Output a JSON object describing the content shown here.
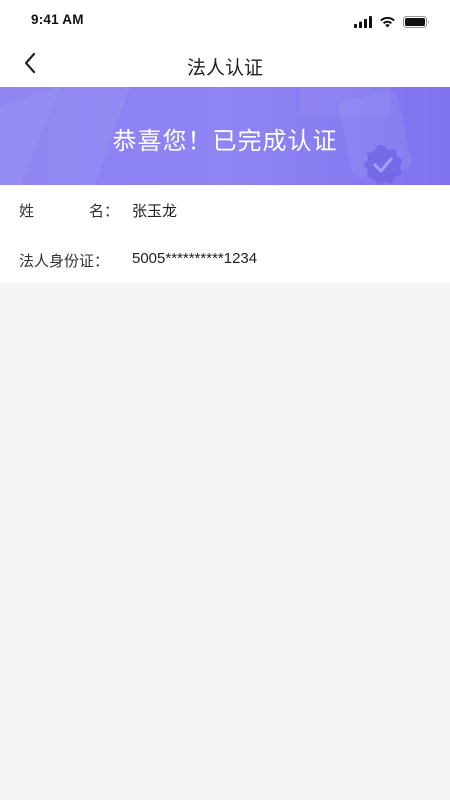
{
  "status_bar": {
    "time": "9:41 AM",
    "icons": [
      "cellular-signal-icon",
      "wifi-icon",
      "battery-icon"
    ]
  },
  "nav": {
    "title": "法人认证",
    "back_icon": "chevron-left-icon"
  },
  "banner": {
    "text": "恭喜您！已完成认证",
    "badge_icon": "verified-badge-icon",
    "gradient_colors": [
      "#8a7ff2",
      "#7f73ef"
    ]
  },
  "info": {
    "name": {
      "label": "姓名：",
      "label_chars": [
        "姓",
        "名："
      ],
      "value": "张玉龙"
    },
    "id_card": {
      "label": "法人身份证：",
      "value": "5005**********1234"
    }
  },
  "colors": {
    "page_background": "#f5f5f6",
    "banner_accent": "#8a7ff2",
    "text_primary": "#222222"
  }
}
